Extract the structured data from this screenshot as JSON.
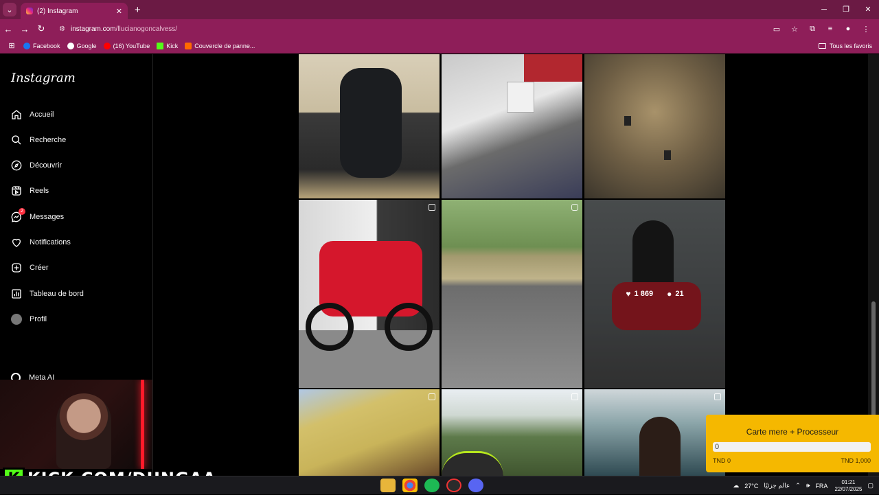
{
  "browser": {
    "tab_title": "(2) Instagram",
    "url_host": "instagram.com",
    "url_path": "/llucianogoncalvess/",
    "bookmarks": [
      {
        "label": "Facebook",
        "color": "#1877f2"
      },
      {
        "label": "Google",
        "color": "#ea4335"
      },
      {
        "label": "(16) YouTube",
        "color": "#ff0000"
      },
      {
        "label": "Kick",
        "color": "#53fc18"
      },
      {
        "label": "Couvercle de panne...",
        "color": "#ff6a00"
      }
    ],
    "all_bookmarks": "Tous les favoris"
  },
  "sidebar": {
    "logo": "Instagram",
    "items": [
      {
        "label": "Accueil",
        "icon": "home-icon"
      },
      {
        "label": "Recherche",
        "icon": "search-icon"
      },
      {
        "label": "Découvrir",
        "icon": "compass-icon"
      },
      {
        "label": "Reels",
        "icon": "reels-icon"
      },
      {
        "label": "Messages",
        "icon": "messenger-icon",
        "badge": "2"
      },
      {
        "label": "Notifications",
        "icon": "heart-icon"
      },
      {
        "label": "Créer",
        "icon": "plus-square-icon"
      },
      {
        "label": "Tableau de bord",
        "icon": "dashboard-icon"
      },
      {
        "label": "Profil",
        "icon": "avatar-icon"
      }
    ],
    "meta_ai": "Meta AI"
  },
  "grid": {
    "hover_post": {
      "likes": "1 869",
      "comments": "21"
    }
  },
  "overlay": {
    "kick_text": "KICK.COM/DUNGAA"
  },
  "donation": {
    "title": "Carte mere + Processeur",
    "current": "0",
    "min": "TND 0",
    "max": "TND 1,000"
  },
  "taskbar": {
    "weather": "27°C",
    "weather_text": "عالم جزئيًا",
    "lang": "FRA",
    "time": "01:21",
    "date": "22/07/2025"
  }
}
